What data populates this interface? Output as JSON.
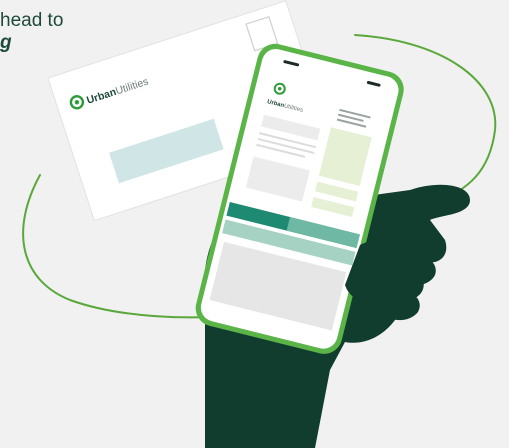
{
  "intro": {
    "line1": "head to",
    "line2": "g"
  },
  "envelope": {
    "brand_bold": "Urban",
    "brand_light": "Utilities"
  },
  "phone": {
    "brand_bold": "Urban",
    "brand_light": "Utilities"
  },
  "colors": {
    "background": "#f1f1f1",
    "brand_green": "#2e9b3a",
    "dark_green": "#103d2e",
    "teal": "#1e8a72",
    "light_blue": "#cfe5e6",
    "pale_green": "#e6f0d4"
  },
  "icons": {
    "logo": "urban-utilities-swirl-icon"
  }
}
